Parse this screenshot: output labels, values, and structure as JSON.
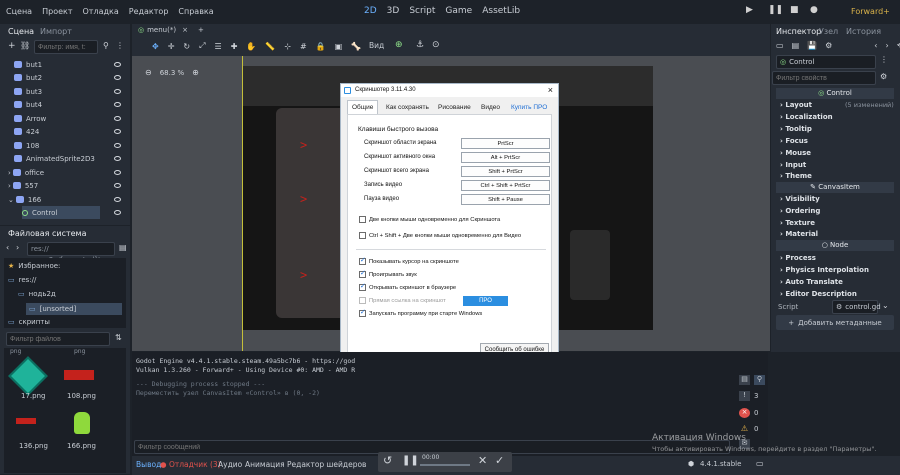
{
  "menu": [
    "Сцена",
    "Проект",
    "Отладка",
    "Редактор",
    "Справка"
  ],
  "modes": [
    "2D",
    "3D",
    "Script",
    "Game",
    "AssetLib"
  ],
  "renderer": "Forward+",
  "scene_dock": {
    "tabs": [
      "Сцена",
      "Импорт"
    ],
    "filter_placeholder": "Фильтр: имя, t:",
    "nodes": [
      "but1",
      "but2",
      "but3",
      "but4",
      "Arrow",
      "424",
      "108",
      "AnimatedSprite2D3",
      "office",
      "557",
      "166",
      "Control"
    ]
  },
  "filesystem": {
    "title": "Файловая система",
    "path": "res://нодь2д/[unsorted]/",
    "items": [
      "Избранное:",
      "res://",
      "нодь2д",
      "[unsorted]",
      "скрипты"
    ],
    "filter_placeholder": "Фильтр файлов",
    "thumb_top": [
      "png",
      "png"
    ],
    "files": [
      "17.png",
      "108.png",
      "136.png",
      "166.png"
    ]
  },
  "editor": {
    "tab": "menu(*)",
    "view_label": "Вид",
    "zoom": "68.3 %"
  },
  "dialog": {
    "title": "Скриншотер 3.11.4.30",
    "close": "×",
    "tabs": [
      "Общие",
      "Как сохранять",
      "Рисование",
      "Видео",
      "Купить ПРО"
    ],
    "hotkeys_title": "Клавиши быстрого вызова",
    "hotkeys": [
      {
        "label": "Скриншот области экрана",
        "key": "PrtScr"
      },
      {
        "label": "Скриншот активного окна",
        "key": "Alt + PrtScr"
      },
      {
        "label": "Скриншот всего экрана",
        "key": "Shift + PrtScr"
      },
      {
        "label": "Запись видео",
        "key": "Ctrl + Shift + PrtScr"
      },
      {
        "label": "Пауза видео",
        "key": "Shift + Pause"
      }
    ],
    "two_keys_screenshot": "Две кнопки мыши одновременно для Скриншота",
    "two_keys_video": "Ctrl + Shift + Две кнопки мыши одновременно для Видео",
    "options": [
      "Показывать курсор на скриншоте",
      "Проигрывать звук",
      "Открывать скриншот в браузере",
      "Прямая ссылка на скриншот",
      "Запускать программу при старте Windows"
    ],
    "pro_badge": "ПРО",
    "report_button": "Сообщить об ошибке"
  },
  "inspector": {
    "tabs": [
      "Инспектор",
      "Узел",
      "История"
    ],
    "node": "Control",
    "filter_placeholder": "Фильтр свойств",
    "sections_control": [
      "Layout",
      "Localization",
      "Tooltip",
      "Focus",
      "Mouse",
      "Input",
      "Theme"
    ],
    "changes": "(5 изменений)",
    "sections_canvas": [
      "Visibility",
      "Ordering",
      "Texture",
      "Material"
    ],
    "sections_node": [
      "Process",
      "Physics Interpolation",
      "Auto Translate",
      "Editor Description"
    ],
    "header_control": "Control",
    "header_canvas": "CanvasItem",
    "header_node": "Node",
    "script_label": "Script",
    "script_value": "control.gd",
    "add_metadata": "Добавить метаданные"
  },
  "output": {
    "lines": [
      "Godot Engine v4.4.1.stable.steam.49a5bc7b6 - https://god",
      "Vulkan 1.3.260 - Forward+ - Using Device #0: AMD - AMD R",
      "--- Debugging process stopped ---",
      "Переместить узел CanvasItem «Control» в (0, -2)"
    ],
    "filter_placeholder": "Фильтр сообщений",
    "counts": [
      "3",
      "0",
      "0"
    ],
    "tabs": [
      "Вывод",
      "Отладчик (3)",
      "Аудио",
      "Анимация",
      "Редактор шейдеров"
    ],
    "timer": "00:00",
    "version": "4.4.1.stable"
  },
  "watermark": {
    "line1": "Активация Windows",
    "line2": "Чтобы активировать Windows, перейдите в раздел \"Параметры\"."
  },
  "colors": {
    "accent": "#6cb2ff",
    "bg": "#1d2229",
    "panel": "#262c35",
    "error": "#e0524c",
    "warning": "#e6b34a"
  }
}
